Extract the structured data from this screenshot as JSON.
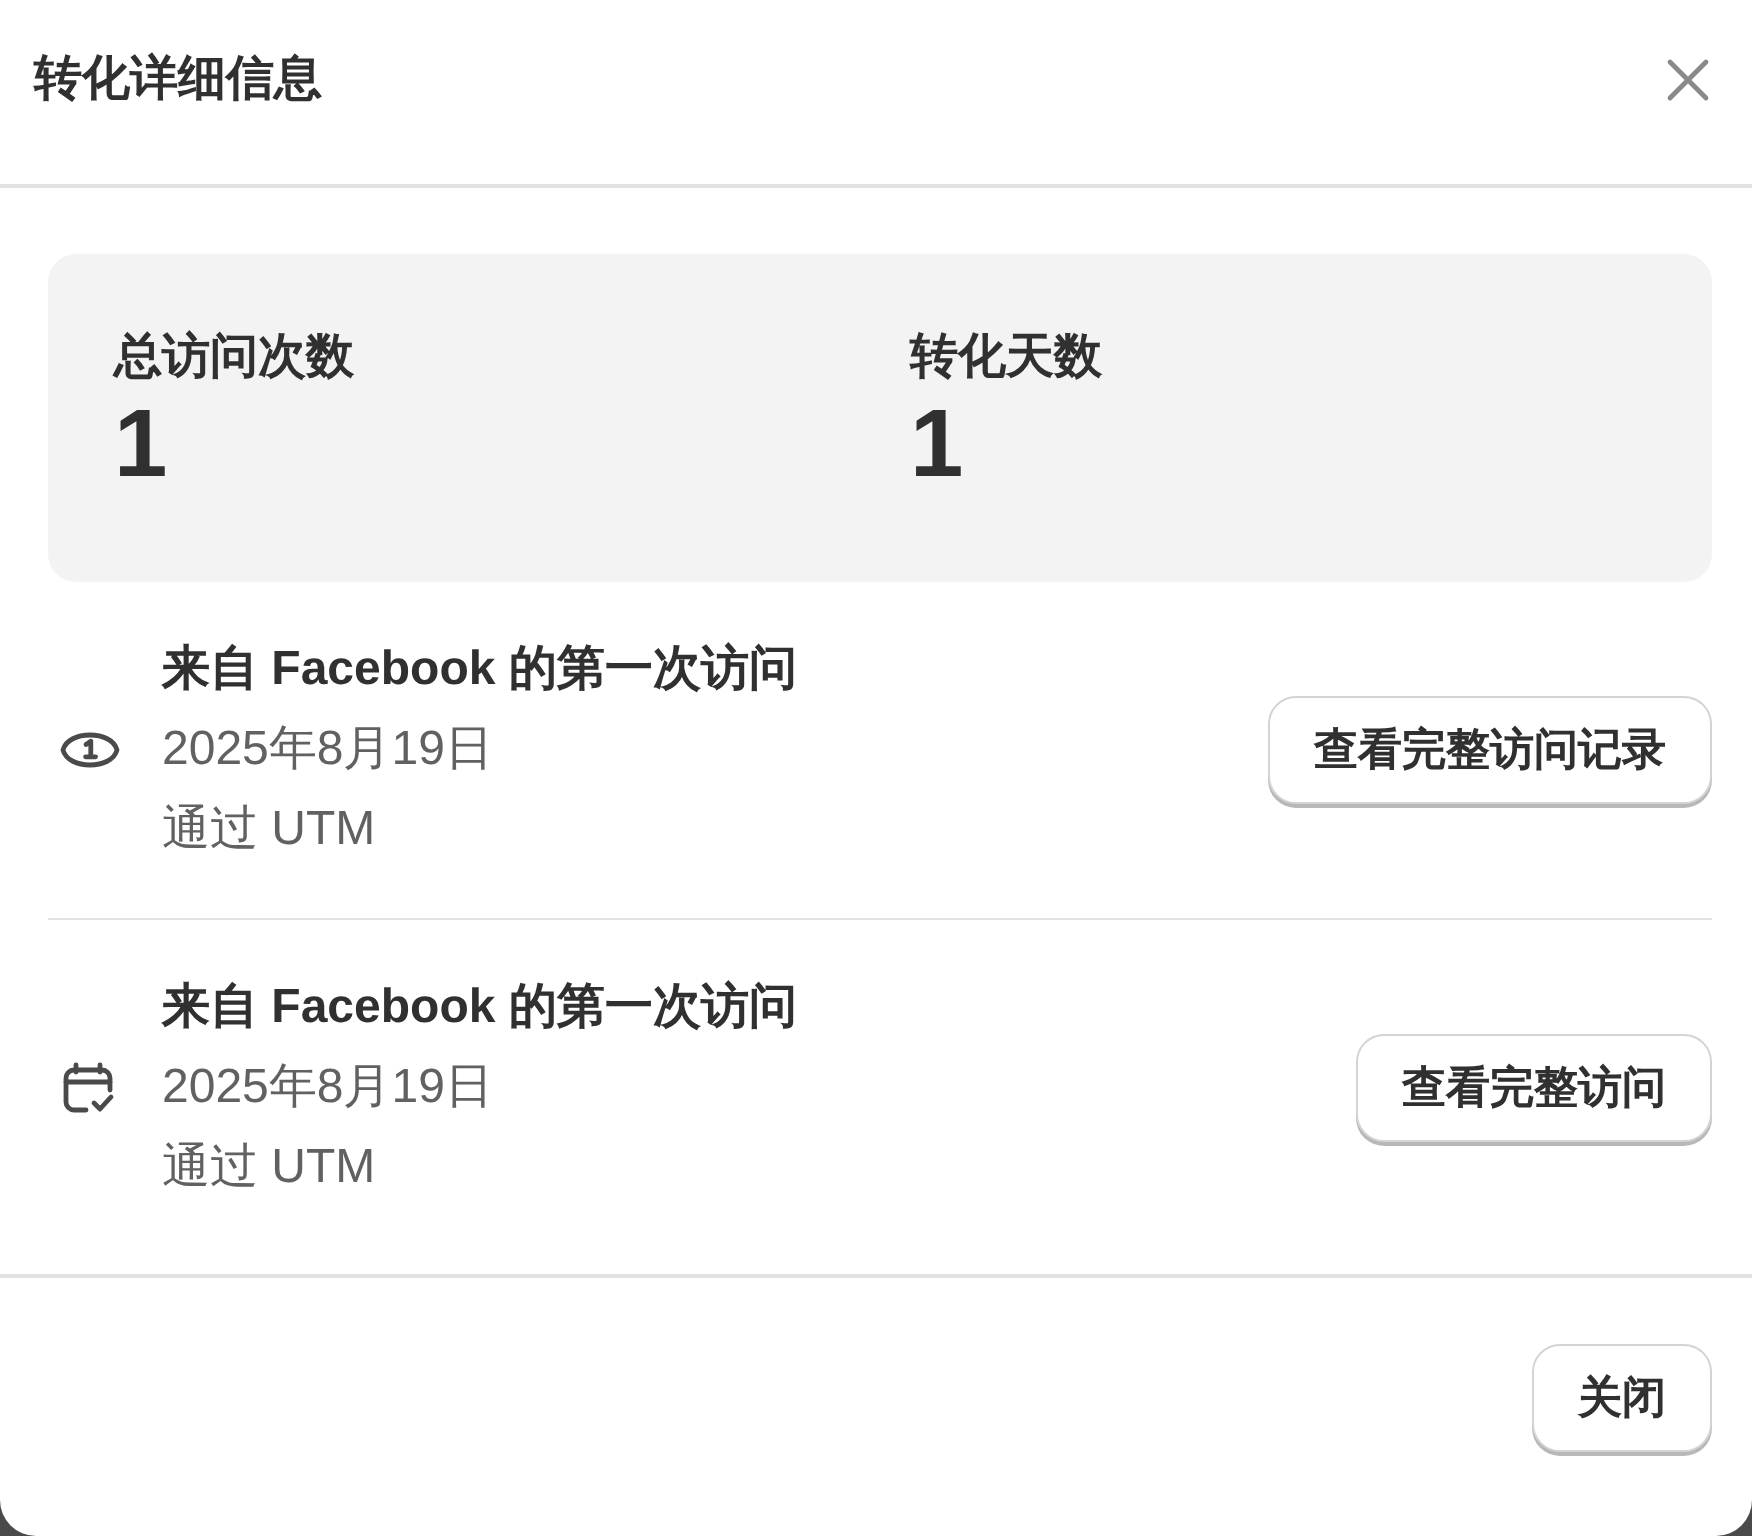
{
  "dialog": {
    "title": "转化详细信息"
  },
  "stats": [
    {
      "label": "总访问次数",
      "value": "1"
    },
    {
      "label": "转化天数",
      "value": "1"
    }
  ],
  "visits": [
    {
      "kind": "first",
      "title": "来自 Facebook 的第一次访问",
      "date": "2025年8月19日",
      "source": "通过 UTM",
      "button": "查看完整访问记录"
    },
    {
      "kind": "conversion",
      "title": "来自 Facebook 的第一次访问",
      "date": "2025年8月19日",
      "source": "通过 UTM",
      "button": "查看完整访问"
    }
  ],
  "footer": {
    "buttons": [
      "关闭"
    ]
  }
}
